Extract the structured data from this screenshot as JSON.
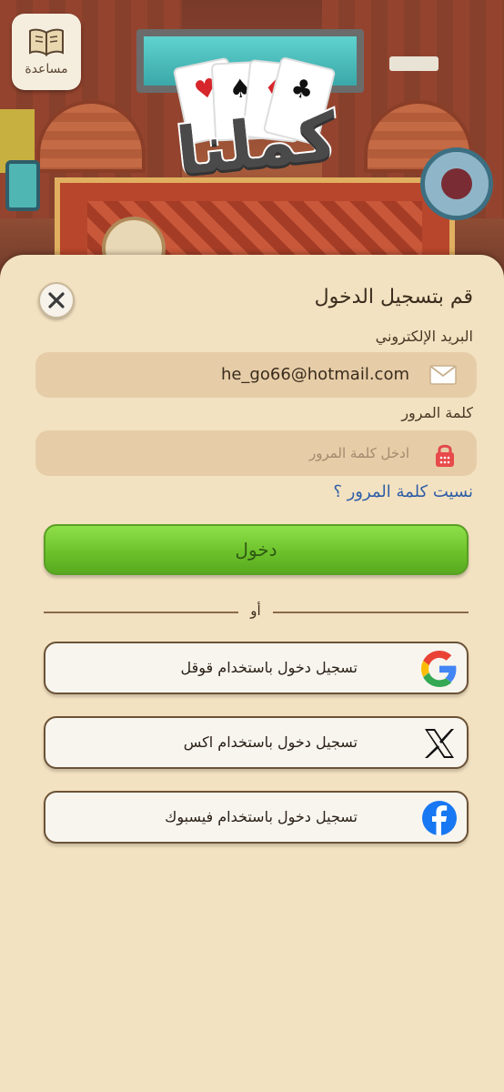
{
  "help": {
    "label": "مساعدة",
    "icon": "book-icon"
  },
  "logo": {
    "word": "كملنا",
    "card_suits": [
      "♥",
      "♠",
      "♦",
      "♣"
    ]
  },
  "login": {
    "title": "قم بتسجيل الدخول",
    "email_label": "البريد الإلكتروني",
    "email_value": "he_go66@hotmail.com",
    "password_label": "كلمة المرور",
    "password_placeholder": "ادخل كلمة المرور",
    "forgot_link": "نسيت كلمة المرور ؟",
    "submit_label": "دخول",
    "or_text": "أو"
  },
  "social": [
    {
      "label": "تسجيل دخول باستخدام قوقل",
      "icon": "google-icon"
    },
    {
      "label": "تسجيل دخول باستخدام اكس",
      "icon": "x-logo-icon"
    },
    {
      "label": "تسجيل دخول باستخدام فيسبوك",
      "icon": "facebook-icon"
    }
  ],
  "colors": {
    "panel_bg": "#f3e2c1",
    "field_bg": "#e6cda8",
    "login_green": "#6dc22b",
    "link_blue": "#2f5ea7",
    "facebook_blue": "#1877f2"
  }
}
